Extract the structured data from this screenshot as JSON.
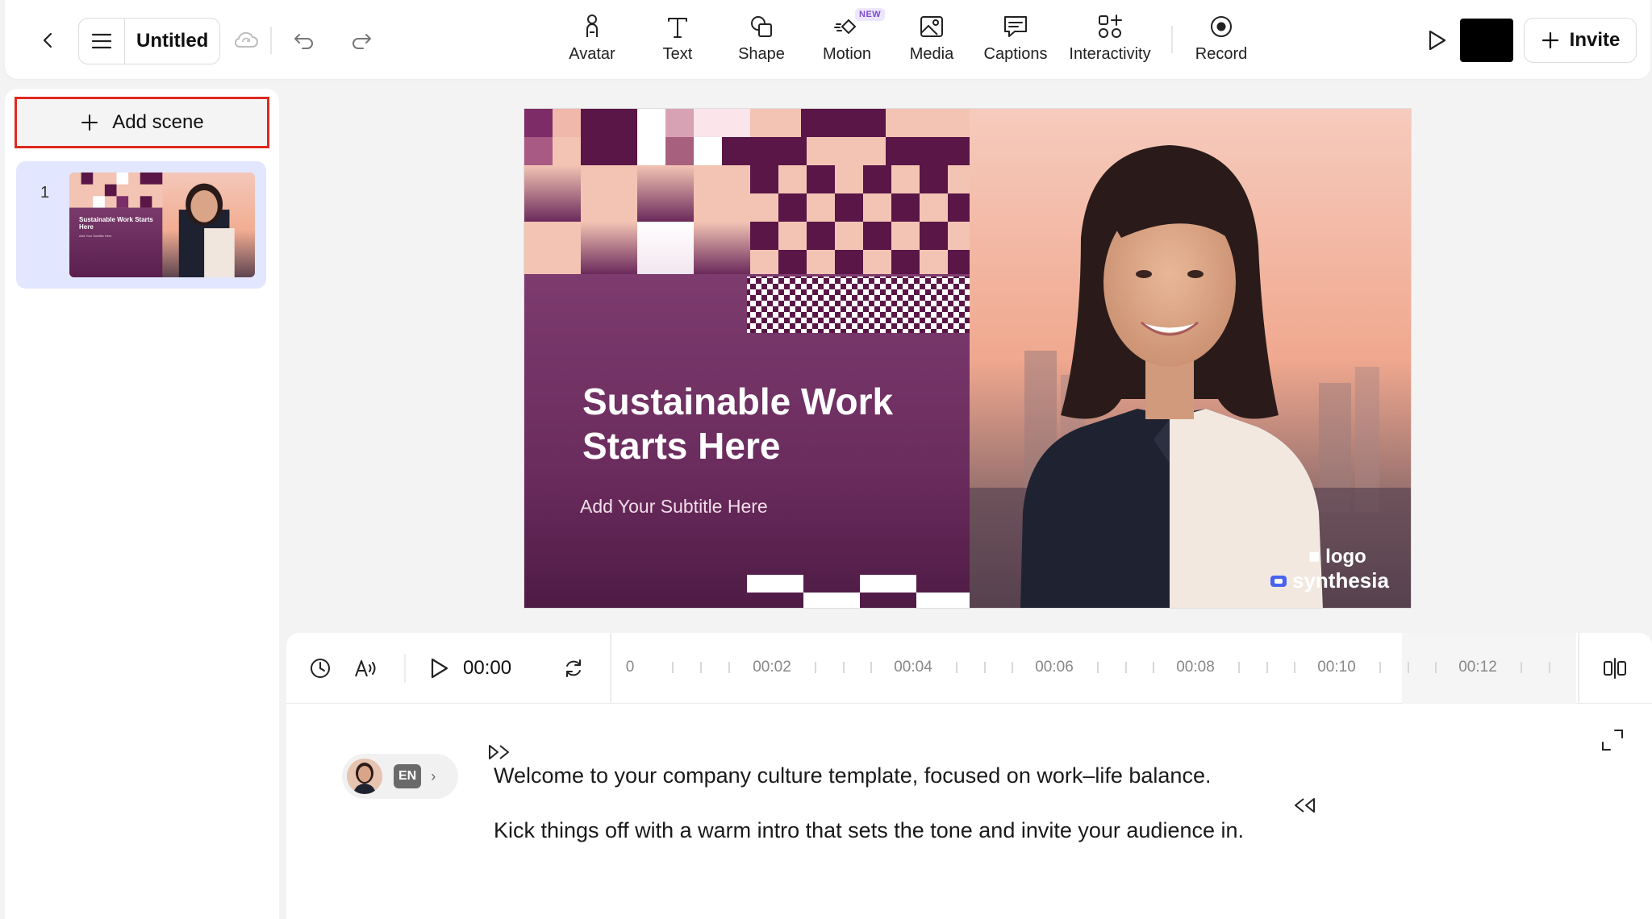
{
  "header": {
    "doc_title": "Untitled",
    "tools": [
      {
        "label": "Avatar",
        "icon": "avatar-icon"
      },
      {
        "label": "Text",
        "icon": "text-icon"
      },
      {
        "label": "Shape",
        "icon": "shape-icon"
      },
      {
        "label": "Motion",
        "icon": "motion-icon",
        "badge": "NEW"
      },
      {
        "label": "Media",
        "icon": "media-icon"
      },
      {
        "label": "Captions",
        "icon": "captions-icon"
      },
      {
        "label": "Interactivity",
        "icon": "interactivity-icon"
      },
      {
        "label": "Record",
        "icon": "record-icon"
      }
    ],
    "invite_label": "Invite",
    "swatch_color": "#000000"
  },
  "scenes": {
    "add_label": "Add scene",
    "items": [
      {
        "number": "1",
        "thumb_title": "Sustainable Work Starts Here",
        "thumb_subtitle": "Add Your Subtitle Here"
      }
    ]
  },
  "canvas": {
    "title": "Sustainable Work Starts Here",
    "subtitle": "Add Your Subtitle Here",
    "logo_text": "logo",
    "brand_text": "synthesia",
    "accent_color": "#6b2a5c"
  },
  "timeline": {
    "current_time": "00:00",
    "ruler_labels": [
      "0",
      "00:02",
      "00:04",
      "00:06",
      "00:08",
      "00:10",
      "00:12"
    ]
  },
  "script": {
    "language": "EN",
    "lines": [
      "Welcome to your company culture template, focused on work–life balance.",
      "Kick things off with a warm intro that sets the tone and invite your audience in."
    ]
  }
}
